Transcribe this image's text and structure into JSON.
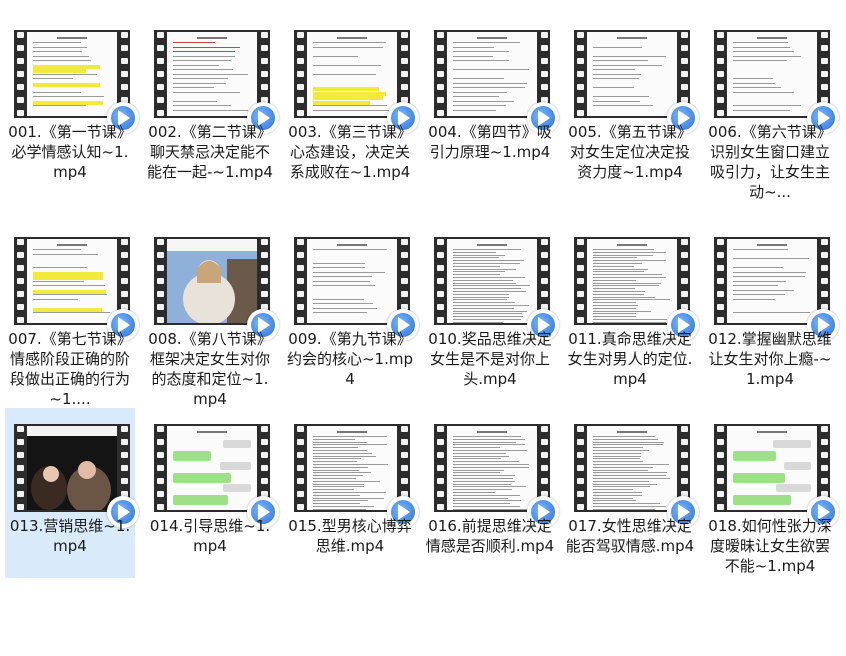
{
  "files": [
    {
      "label": "001.《第一节课》必学情感认知~1.mp4",
      "thumb": "doc-yellow"
    },
    {
      "label": "002.《第二节课》聊天禁忌决定能不能在一起-~1.mp4",
      "thumb": "doc-red"
    },
    {
      "label": "003.《第三节课》心态建设，决定关系成败在~1.mp4",
      "thumb": "doc-yellow-bottom"
    },
    {
      "label": "004.《第四节》吸引力原理~1.mp4",
      "thumb": "doc-plain"
    },
    {
      "label": "005.《第五节课》对女生定位决定投资力度~1.mp4",
      "thumb": "doc-plain"
    },
    {
      "label": "006.《第六节课》识别女生窗口建立吸引力，让女生主动~...",
      "thumb": "doc-plain"
    },
    {
      "label": "007.《第七节课》情感阶段正确的阶段做出正确的行为~1....",
      "thumb": "doc-yellow"
    },
    {
      "label": "008.《第八节课》框架决定女生对你的态度和定位~1.mp4",
      "thumb": "photo-girl"
    },
    {
      "label": "009.《第九节课》约会的核心~1.mp4",
      "thumb": "doc-plain"
    },
    {
      "label": "010.奖品思维决定女生是不是对你上头.mp4",
      "thumb": "doc-dense"
    },
    {
      "label": "011.真命思维决定女生对男人的定位.mp4",
      "thumb": "doc-dense"
    },
    {
      "label": "012.掌握幽默思维让女生对你上瘾-~1.mp4",
      "thumb": "doc-plain"
    },
    {
      "label": "013.营销思维~1.mp4",
      "thumb": "photo-dark"
    },
    {
      "label": "014.引导思维~1.mp4",
      "thumb": "chat"
    },
    {
      "label": "015.型男核心博弈思维.mp4",
      "thumb": "doc-dense"
    },
    {
      "label": "016.前提思维决定情感是否顺利.mp4",
      "thumb": "doc-dense"
    },
    {
      "label": "017.女性思维决定能否驾驭情感.mp4",
      "thumb": "doc-dense"
    },
    {
      "label": "018.如何性张力深度暧昧让女生欲罢不能~1.mp4",
      "thumb": "chat"
    }
  ],
  "selected_index": 12,
  "colors": {
    "selection": "#d9ebfb",
    "film": "#2c2c2c",
    "play": "#2a6fd6",
    "highlight": "#f2ea3a"
  }
}
